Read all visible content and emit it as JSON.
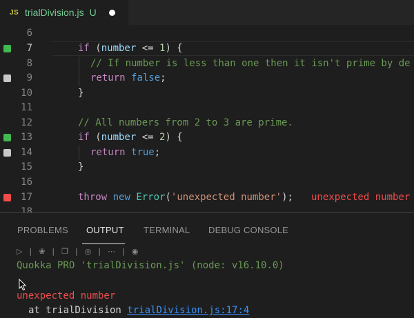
{
  "tab": {
    "icon": "JS",
    "title": "trialDivision.js",
    "status": "U",
    "dirty_icon": "unsaved-dot-icon"
  },
  "editor": {
    "lines": [
      {
        "n": "6",
        "mark": "",
        "text": ""
      },
      {
        "n": "7",
        "mark": "covered",
        "text": "if (number <= 1) {"
      },
      {
        "n": "8",
        "mark": "",
        "text": "// If number is less than one then it isn't prime by de"
      },
      {
        "n": "9",
        "mark": "uncovered",
        "text": "return false;"
      },
      {
        "n": "10",
        "mark": "",
        "text": "}"
      },
      {
        "n": "11",
        "mark": "",
        "text": ""
      },
      {
        "n": "12",
        "mark": "",
        "text": "// All numbers from 2 to 3 are prime."
      },
      {
        "n": "13",
        "mark": "covered",
        "text": "if (number <= 2) {"
      },
      {
        "n": "14",
        "mark": "uncovered",
        "text": "return true;"
      },
      {
        "n": "15",
        "mark": "",
        "text": "}"
      },
      {
        "n": "16",
        "mark": "",
        "text": ""
      },
      {
        "n": "17",
        "mark": "error",
        "text": "throw new Error('unexpected number');"
      },
      {
        "n": "18",
        "mark": "",
        "text": ""
      }
    ],
    "inline_error": "unexpected number",
    "colors": {
      "covered": "#3fb950",
      "uncovered": "#c8c8c8",
      "error": "#f14c4c"
    }
  },
  "panel": {
    "tabs": [
      "PROBLEMS",
      "OUTPUT",
      "TERMINAL",
      "DEBUG CONSOLE"
    ],
    "active_tab": "OUTPUT",
    "toolbar_icons": [
      "play-icon",
      "bug-icon",
      "copy-icon",
      "lightbulb-icon",
      "settings-sliders-icon",
      "record-icon"
    ],
    "output": {
      "header": "Quokka PRO 'trialDivision.js' (node: v16.10.0)",
      "error": "unexpected number",
      "stack_prefix": "at trialDivision",
      "stack_link": "trialDivision.js:17:4"
    }
  }
}
